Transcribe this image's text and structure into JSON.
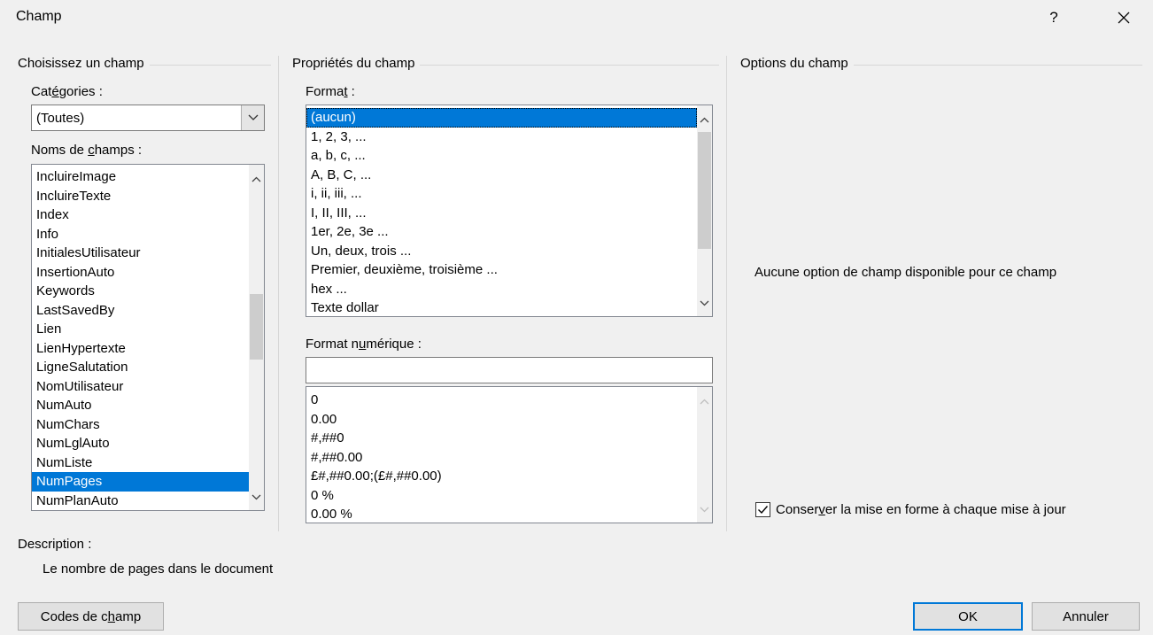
{
  "window": {
    "title": "Champ",
    "help_glyph": "?",
    "close_glyph": "✕"
  },
  "choose_field": {
    "group_title": "Choisissez un champ",
    "categories_label_pre": "Cat",
    "categories_label_u": "é",
    "categories_label_post": "gories :",
    "categories_value": "(Toutes)",
    "field_names_label_pre": "Noms de ",
    "field_names_label_u": "c",
    "field_names_label_post": "hamps :",
    "field_names": [
      "IncluireImage",
      "IncluireTexte",
      "Index",
      "Info",
      "InitialesUtilisateur",
      "InsertionAuto",
      "Keywords",
      "LastSavedBy",
      "Lien",
      "LienHypertexte",
      "LigneSalutation",
      "NomUtilisateur",
      "NumAuto",
      "NumChars",
      "NumLglAuto",
      "NumListe",
      "NumPages",
      "NumPlanAuto"
    ],
    "selected_field": "NumPages"
  },
  "field_properties": {
    "group_title": "Propriétés du champ",
    "format_label_pre": "Forma",
    "format_label_u": "t",
    "format_label_post": " :",
    "formats": [
      "(aucun)",
      "1, 2, 3, ...",
      "a, b, c, ...",
      "A, B, C, ...",
      "i, ii, iii, ...",
      "I, II, III, ...",
      "1er, 2e, 3e ...",
      "Un, deux, trois ...",
      "Premier, deuxième, troisième ...",
      "hex ...",
      "Texte dollar"
    ],
    "selected_format": "(aucun)",
    "numeric_format_label_pre": "Format n",
    "numeric_format_label_u": "u",
    "numeric_format_label_post": "mérique :",
    "numeric_format_value": "",
    "numeric_formats": [
      "0",
      "0.00",
      "#,##0",
      "#,##0.00",
      "£#,##0.00;(£#,##0.00)",
      "0 %",
      "0.00 %"
    ]
  },
  "field_options": {
    "group_title": "Options du champ",
    "no_options_text": "Aucune option de champ disponible pour ce champ",
    "preserve_checkbox_pre": "Conser",
    "preserve_checkbox_u": "v",
    "preserve_checkbox_post": "er la mise en forme à chaque mise à jour",
    "preserve_checked": true
  },
  "description": {
    "label": "Description :",
    "text": "Le nombre de pages dans le document"
  },
  "buttons": {
    "field_codes_pre": "Codes de c",
    "field_codes_u": "h",
    "field_codes_post": "amp",
    "ok": "OK",
    "cancel": "Annuler"
  },
  "colors": {
    "selection": "#0078d7",
    "dialog_bg": "#f0f0f0"
  }
}
